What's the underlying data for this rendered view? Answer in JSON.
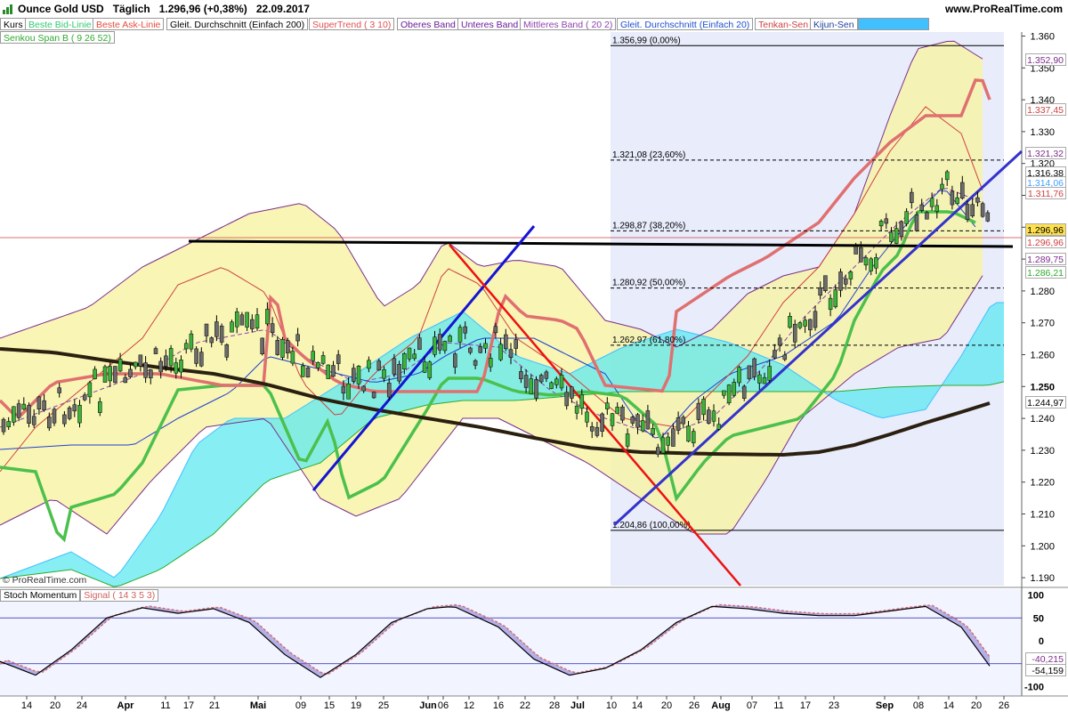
{
  "header": {
    "instrument": "Ounce Gold USD",
    "period": "Täglich",
    "quote": "1.296,96 (+0,38%)",
    "date": "22.09.2017",
    "site": "www.ProRealTime.com"
  },
  "legend_row1": [
    {
      "label": "Kurs",
      "color": "#000000"
    },
    {
      "label": "Beste Bid-Linie",
      "color": "#2ecc71"
    },
    {
      "label": "Beste Ask-Linie",
      "color": "#e74c3c"
    },
    {
      "label": "Gleit. Durchschnitt (Einfach 200)",
      "color": "#000000"
    },
    {
      "label": "SuperTrend ( 3 10)",
      "color": "#e05050"
    },
    {
      "label": "Oberes Band",
      "color": "#6a1b9a"
    },
    {
      "label": "Unteres Band",
      "color": "#6a1b9a"
    },
    {
      "label": "Mittleres Band ( 20 2)",
      "color": "#8e44ad"
    },
    {
      "label": "Gleit. Durchschnitt (Einfach 20)",
      "color": "#1f4fd1"
    },
    {
      "label": "Tenkan-Sen",
      "color": "#d04040"
    },
    {
      "label": "Kijun-Sen",
      "color": "#1f3fa0"
    },
    {
      "label": "Senkou Span A",
      "color": "#40c0ff"
    }
  ],
  "legend_row2": [
    {
      "label": "Senkou Span B ( 9 26 52)",
      "color": "#2eaa2e"
    }
  ],
  "fibo_levels": [
    {
      "label": "1.356,99 (0,00%)",
      "value": 1356.99
    },
    {
      "label": "1.321,08 (23,60%)",
      "value": 1321.08
    },
    {
      "label": "1.298,87 (38,20%)",
      "value": 1298.87
    },
    {
      "label": "1.280,92 (50,00%)",
      "value": 1280.92
    },
    {
      "label": "1.262,97 (61,80%)",
      "value": 1262.97
    },
    {
      "label": "1.204,86 (100,00%)",
      "value": 1204.86
    }
  ],
  "price_axis_ticks": [
    "1.360",
    "1.350",
    "1.340",
    "1.330",
    "1.320",
    "1.310",
    "1.300",
    "1.290",
    "1.280",
    "1.270",
    "1.260",
    "1.250",
    "1.240",
    "1.230",
    "1.220",
    "1.210",
    "1.200",
    "1.190"
  ],
  "price_boxes": [
    {
      "label": "1.352,90",
      "value": 1352.9,
      "bg": "#ffffff",
      "fg": "#7b2d8b"
    },
    {
      "label": "1.337,45",
      "value": 1337.45,
      "bg": "#ffffff",
      "fg": "#d04040"
    },
    {
      "label": "1.321,32",
      "value": 1321.32,
      "bg": "#ffffff",
      "fg": "#7b2d8b"
    },
    {
      "label": "1.316,38",
      "value": 1316.38,
      "bg": "#ffffff",
      "fg": "#000000"
    },
    {
      "label": "1.314,06",
      "value": 1314.06,
      "bg": "#ffffff",
      "fg": "#3fa0ff"
    },
    {
      "label": "1.311,76",
      "value": 1311.76,
      "bg": "#ffffff",
      "fg": "#d04040"
    },
    {
      "label": "1.296,96",
      "value": 1296.96,
      "bg": "#ffe14d",
      "fg": "#000000"
    },
    {
      "label": "1.296,96",
      "value": 1296.96,
      "bg": "#ffffff",
      "fg": "#d04040"
    },
    {
      "label": "1.289,75",
      "value": 1289.75,
      "bg": "#ffffff",
      "fg": "#7b2d8b"
    },
    {
      "label": "1.286,21",
      "value": 1286.21,
      "bg": "#ffffff",
      "fg": "#2eaa2e"
    },
    {
      "label": "1.244,97",
      "value": 1244.97,
      "bg": "#ffffff",
      "fg": "#000000"
    }
  ],
  "stoch": {
    "legend_name": "Stoch Momentum",
    "legend_signal": "Signal ( 14 3 5 3)",
    "ticks": [
      "100",
      "50",
      "0",
      "-50",
      "-100"
    ],
    "values": [
      {
        "label": "-40,215",
        "value": -40.215,
        "fg": "#7b2d8b"
      },
      {
        "label": "-54,159",
        "value": -54.159,
        "fg": "#000000"
      }
    ]
  },
  "x_labels": [
    "14",
    "20",
    "24",
    "Apr",
    "11",
    "17",
    "21",
    "Mai",
    "09",
    "15",
    "19",
    "25",
    "Jun",
    "06",
    "12",
    "16",
    "22",
    "28",
    "Jul",
    "10",
    "14",
    "20",
    "26",
    "Aug",
    "07",
    "11",
    "17",
    "23",
    "Sep",
    "08",
    "14",
    "20",
    "26"
  ],
  "watermark": "© ProRealTime.com",
  "chart_data": {
    "type": "candlestick",
    "title": "Ounce Gold USD",
    "ylim": [
      1185,
      1365
    ],
    "close_last": 1296.96,
    "sma200_end": 1244.97,
    "resistance_level": 1296.5,
    "fibonacci_high": 1356.99,
    "fibonacci_low": 1204.86
  }
}
